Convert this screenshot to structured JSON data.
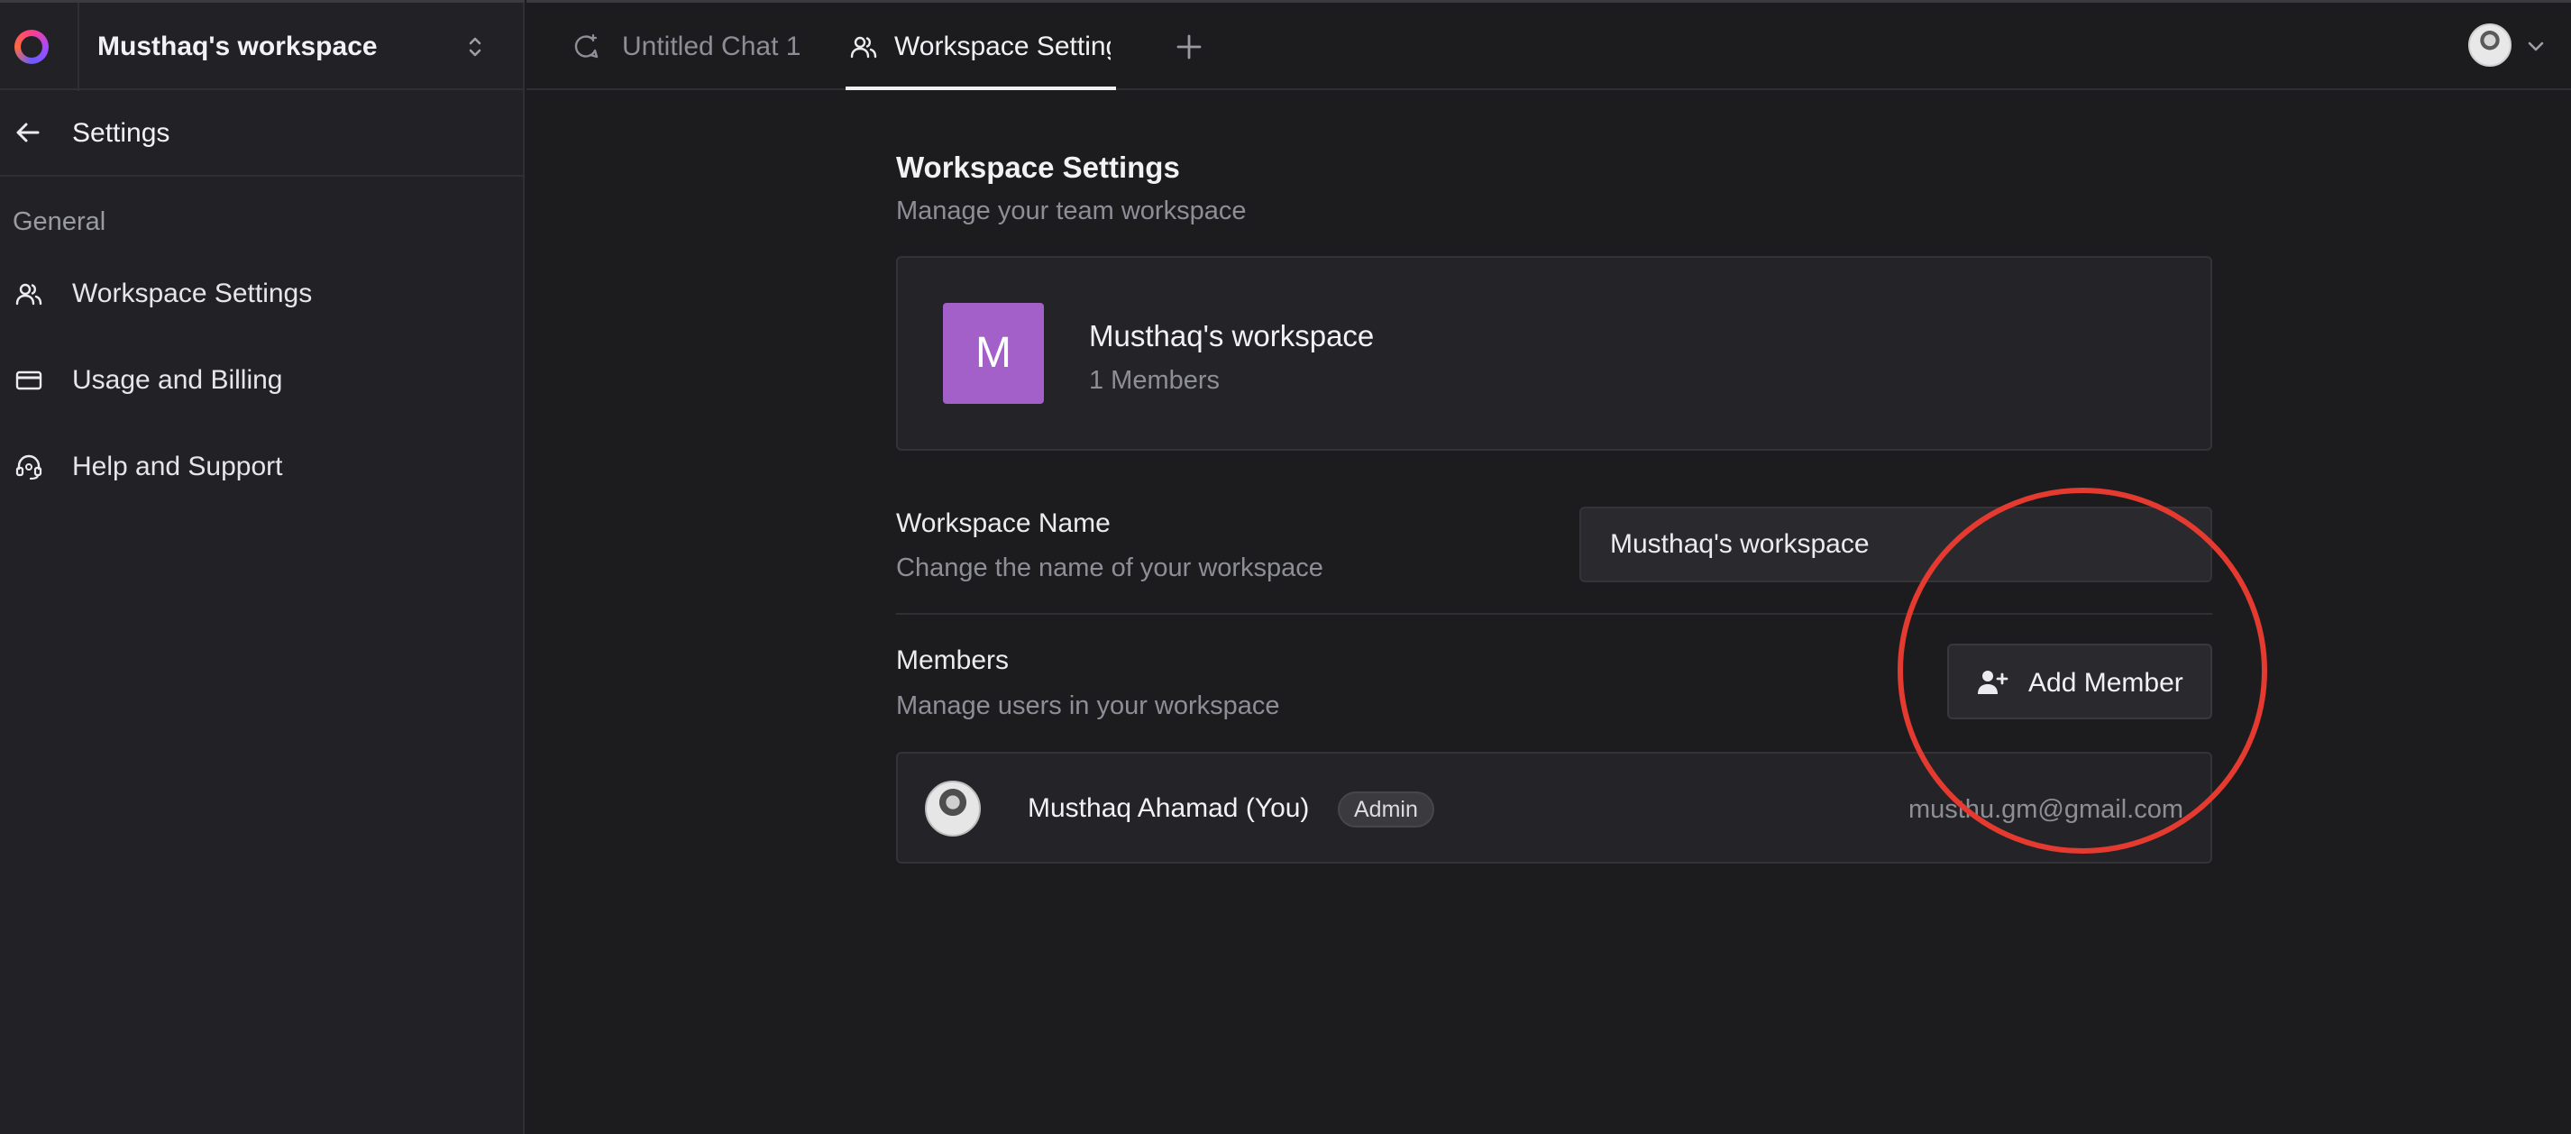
{
  "workspace_switcher": {
    "name": "Musthaq's workspace"
  },
  "settings_header": {
    "title": "Settings"
  },
  "sidebar": {
    "section": "General",
    "items": [
      {
        "label": "Workspace Settings",
        "icon": "users-icon"
      },
      {
        "label": "Usage and Billing",
        "icon": "credit-card-icon"
      },
      {
        "label": "Help and Support",
        "icon": "headset-icon"
      }
    ]
  },
  "tabs": [
    {
      "label": "Untitled Chat 1",
      "icon": "chat-icon",
      "active": false
    },
    {
      "label": "Workspace Settings",
      "icon": "users-icon",
      "active": true
    }
  ],
  "main": {
    "title": "Workspace Settings",
    "subtitle": "Manage your team workspace",
    "card": {
      "initial": "M",
      "name": "Musthaq's workspace",
      "members": "1 Members",
      "color": "#a360c8"
    },
    "name_field": {
      "label": "Workspace Name",
      "description": "Change the name of your workspace",
      "value": "Musthaq's workspace"
    },
    "members_section": {
      "label": "Members",
      "description": "Manage users in your workspace",
      "add_button": "Add Member"
    },
    "members": [
      {
        "name": "Musthaq Ahamad (You)",
        "role": "Admin",
        "email": "musthu.gm@gmail.com"
      }
    ]
  },
  "colors": {
    "background": "#1c1c1f",
    "sidebar": "#222226",
    "accent": "#a360c8",
    "annotation": "#e53a2f"
  }
}
